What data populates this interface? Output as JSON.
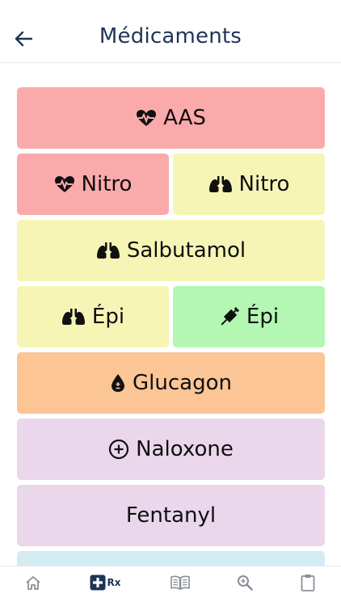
{
  "header": {
    "title": "Médicaments",
    "back_icon": "arrow-left-icon"
  },
  "colors": {
    "red": "#fbaaab",
    "yellow": "#f7f5b5",
    "green": "#b3f7b2",
    "orange": "#fbc596",
    "purple": "#ead7ec",
    "lightblue": "#d3ecf4",
    "title": "#1f3557",
    "nav_icon": "#8b8f96"
  },
  "medications": [
    {
      "label": "AAS",
      "icon": "heart-pulse-icon",
      "color": "red"
    },
    {
      "label": "Nitro",
      "icon": "heart-pulse-icon",
      "color": "red"
    },
    {
      "label": "Nitro",
      "icon": "lungs-icon",
      "color": "yellow"
    },
    {
      "label": "Salbutamol",
      "icon": "lungs-icon",
      "color": "yellow"
    },
    {
      "label": "Épi",
      "icon": "lungs-icon",
      "color": "yellow"
    },
    {
      "label": "Épi",
      "icon": "syringe-icon",
      "color": "green"
    },
    {
      "label": "Glucagon",
      "icon": "drop-plus-minus-icon",
      "color": "orange"
    },
    {
      "label": "Naloxone",
      "icon": "circle-plus-icon",
      "color": "purple"
    },
    {
      "label": "Fentanyl",
      "icon": "",
      "color": "purple"
    }
  ],
  "bottom_nav": {
    "items": [
      {
        "name": "home",
        "icon": "home-icon"
      },
      {
        "name": "rx",
        "icon": "medical-cross-icon",
        "label": "Rx",
        "active": true
      },
      {
        "name": "book",
        "icon": "book-icon"
      },
      {
        "name": "search",
        "icon": "zoom-icon"
      },
      {
        "name": "clipboard",
        "icon": "clipboard-icon"
      }
    ]
  }
}
